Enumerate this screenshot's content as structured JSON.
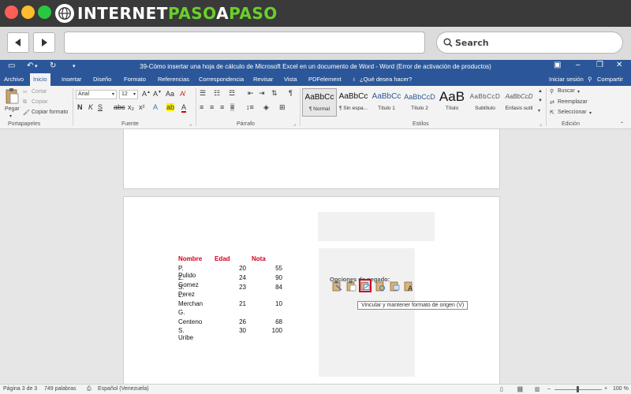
{
  "brand": {
    "part1": "INTERNET",
    "part2": "PASO",
    "part3": "A",
    "part4": "PASO"
  },
  "browser": {
    "search_placeholder": "Search"
  },
  "word": {
    "title": "39-Cómo insertar una hoja de cálculo de Microsoft Excel en un documento de Word - Word (Error de activación de productos)",
    "tabs": [
      "Archivo",
      "Inicio",
      "Insertar",
      "Diseño",
      "Formato",
      "Referencias",
      "Correspondencia",
      "Revisar",
      "Vista",
      "PDFelement"
    ],
    "tell_me": "¿Qué desea hacer?",
    "sign_in": "Iniciar sesión",
    "share": "Compartir"
  },
  "ribbon": {
    "clipboard": {
      "paste": "Pegar",
      "cut": "Cortar",
      "copy": "Copiar",
      "format_painter": "Copiar formato",
      "label": "Portapapeles"
    },
    "font": {
      "name": "Arial",
      "size": "12",
      "label": "Fuente"
    },
    "paragraph": {
      "label": "Párrafo"
    },
    "styles": {
      "label": "Estilos",
      "items": [
        {
          "sample": "AaBbCc",
          "name": "¶ Normal"
        },
        {
          "sample": "AaBbCc",
          "name": "¶ Sin espa..."
        },
        {
          "sample": "AaBbCc",
          "name": "Título 1"
        },
        {
          "sample": "AaBbCcD",
          "name": "Título 2"
        },
        {
          "sample": "AaB",
          "name": "Título"
        },
        {
          "sample": "AaBbCcD",
          "name": "Subtítulo"
        },
        {
          "sample": "AaBbCcD",
          "name": "Énfasis sutil"
        }
      ]
    },
    "editing": {
      "find": "Buscar",
      "replace": "Reemplazar",
      "select": "Seleccionar",
      "label": "Edición"
    }
  },
  "table": {
    "headers": [
      "Nombre",
      "Edad",
      "Nota"
    ],
    "rows": [
      {
        "name": "P. Pulido",
        "age": "20",
        "grade": "55"
      },
      {
        "name": "Z. Gomez",
        "age": "24",
        "grade": "90"
      },
      {
        "name": "S. Perez",
        "age": "23",
        "grade": "84"
      },
      {
        "name": "L.",
        "age": "",
        "grade": ""
      },
      {
        "name": "Merchan",
        "age": "21",
        "grade": "10"
      },
      {
        "name": "G.",
        "age": "",
        "grade": ""
      },
      {
        "name": "Centeno",
        "age": "26",
        "grade": "68"
      },
      {
        "name": "S. Uribe",
        "age": "30",
        "grade": "100"
      }
    ]
  },
  "paste_options": {
    "title": "Opciones de pegado:",
    "tooltip": "Vincular y mantener formato de origen (V)"
  },
  "status": {
    "page": "Página 3 de 3",
    "words": "749 palabras",
    "language": "Español (Venezuela)",
    "zoom": "100 %"
  }
}
